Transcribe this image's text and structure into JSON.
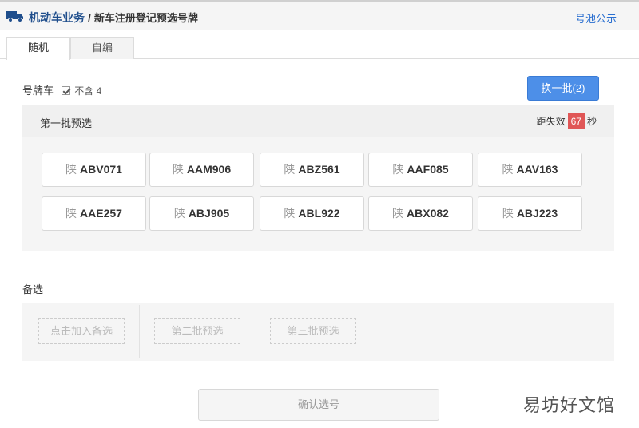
{
  "header": {
    "icon": "truck-icon",
    "breadcrumb_root": "机动车业务",
    "breadcrumb_separator": "/",
    "breadcrumb_current": "新车注册登记预选号牌",
    "pool_link": "号池公示"
  },
  "tabs": [
    {
      "label": "随机",
      "active": true
    },
    {
      "label": "自编",
      "active": false
    }
  ],
  "plate_type": {
    "label": "号牌车",
    "exclude_four_checked": true,
    "exclude_four_label": "不含 4"
  },
  "change_button": "换一批(2)",
  "batch": {
    "title": "第一批预选",
    "expire_prefix": "距失效",
    "seconds_left": "67",
    "expire_suffix": "秒",
    "plates": [
      {
        "prov": "陕",
        "code": "ABV071"
      },
      {
        "prov": "陕",
        "code": "AAM906"
      },
      {
        "prov": "陕",
        "code": "ABZ561"
      },
      {
        "prov": "陕",
        "code": "AAF085"
      },
      {
        "prov": "陕",
        "code": "AAV163"
      },
      {
        "prov": "陕",
        "code": "AAE257"
      },
      {
        "prov": "陕",
        "code": "ABJ905"
      },
      {
        "prov": "陕",
        "code": "ABL922"
      },
      {
        "prov": "陕",
        "code": "ABX082"
      },
      {
        "prov": "陕",
        "code": "ABJ223"
      }
    ]
  },
  "alternates": {
    "title": "备选",
    "add_slot": "点击加入备选",
    "slot2": "第二批预选",
    "slot3": "第三批预选"
  },
  "confirm_button": "确认选号",
  "watermark": "易坊好文馆",
  "colors": {
    "accent_blue": "#4d8fe8",
    "breadcrumb_blue": "#1f4e8c",
    "countdown_red": "#e05656"
  }
}
